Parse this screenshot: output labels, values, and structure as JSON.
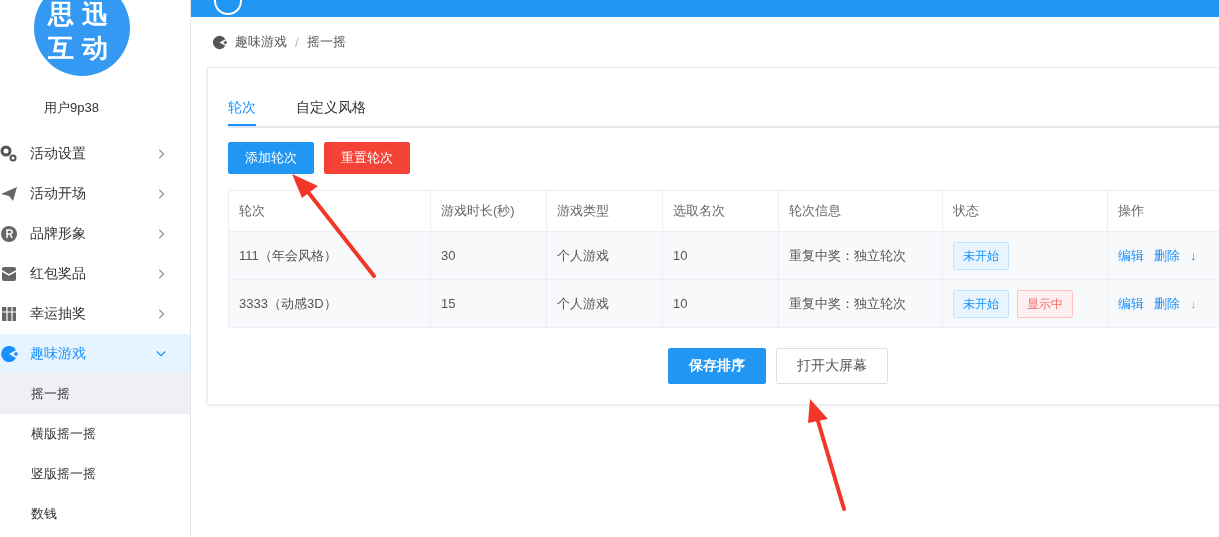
{
  "sidebar": {
    "logo_text": [
      "思迅",
      "互动"
    ],
    "user": "用户9p38",
    "items": [
      {
        "label": "活动设置",
        "expanded": false,
        "selected": false
      },
      {
        "label": "活动开场",
        "expanded": false,
        "selected": false
      },
      {
        "label": "品牌形象",
        "expanded": false,
        "selected": false
      },
      {
        "label": "红包奖品",
        "expanded": false,
        "selected": false
      },
      {
        "label": "幸运抽奖",
        "expanded": false,
        "selected": false
      },
      {
        "label": "趣味游戏",
        "expanded": true,
        "selected": true,
        "children": [
          {
            "label": "摇一摇",
            "selected": true
          },
          {
            "label": "横版摇一摇",
            "selected": false
          },
          {
            "label": "竖版摇一摇",
            "selected": false
          },
          {
            "label": "数钱",
            "selected": false
          }
        ]
      }
    ]
  },
  "breadcrumb": {
    "items": [
      "趣味游戏",
      "摇一摇"
    ],
    "separator": "/"
  },
  "tabs": [
    {
      "label": "轮次",
      "selected": true
    },
    {
      "label": "自定义风格",
      "selected": false
    }
  ],
  "toolbar": [
    {
      "label": "添加轮次",
      "kind": "primary"
    },
    {
      "label": "重置轮次",
      "kind": "danger"
    }
  ],
  "table": {
    "columns": [
      "轮次",
      "游戏时长(秒)",
      "游戏类型",
      "选取名次",
      "轮次信息",
      "状态",
      "操作"
    ],
    "rows": [
      {
        "cells": [
          "111（年会风格）",
          "30",
          "个人游戏",
          "10",
          "重复中奖：独立轮次"
        ],
        "tags": [
          {
            "label": "未开始",
            "kind": "info"
          }
        ],
        "actions": [
          {
            "label": "编辑",
            "disabled": false
          },
          {
            "label": "删除",
            "disabled": false
          },
          {
            "label": "↓",
            "disabled": false
          }
        ]
      },
      {
        "cells": [
          "3333（动感3D）",
          "15",
          "个人游戏",
          "10",
          "重复中奖：独立轮次"
        ],
        "tags": [
          {
            "label": "未开始",
            "kind": "info"
          },
          {
            "label": "显示中",
            "kind": "danger"
          }
        ],
        "actions": [
          {
            "label": "编辑",
            "disabled": false
          },
          {
            "label": "删除",
            "disabled": false
          },
          {
            "label": "↓",
            "disabled": true
          }
        ]
      }
    ]
  },
  "footer_buttons": [
    {
      "label": "保存排序",
      "kind": "primary"
    },
    {
      "label": "打开大屏幕",
      "kind": "default"
    }
  ]
}
